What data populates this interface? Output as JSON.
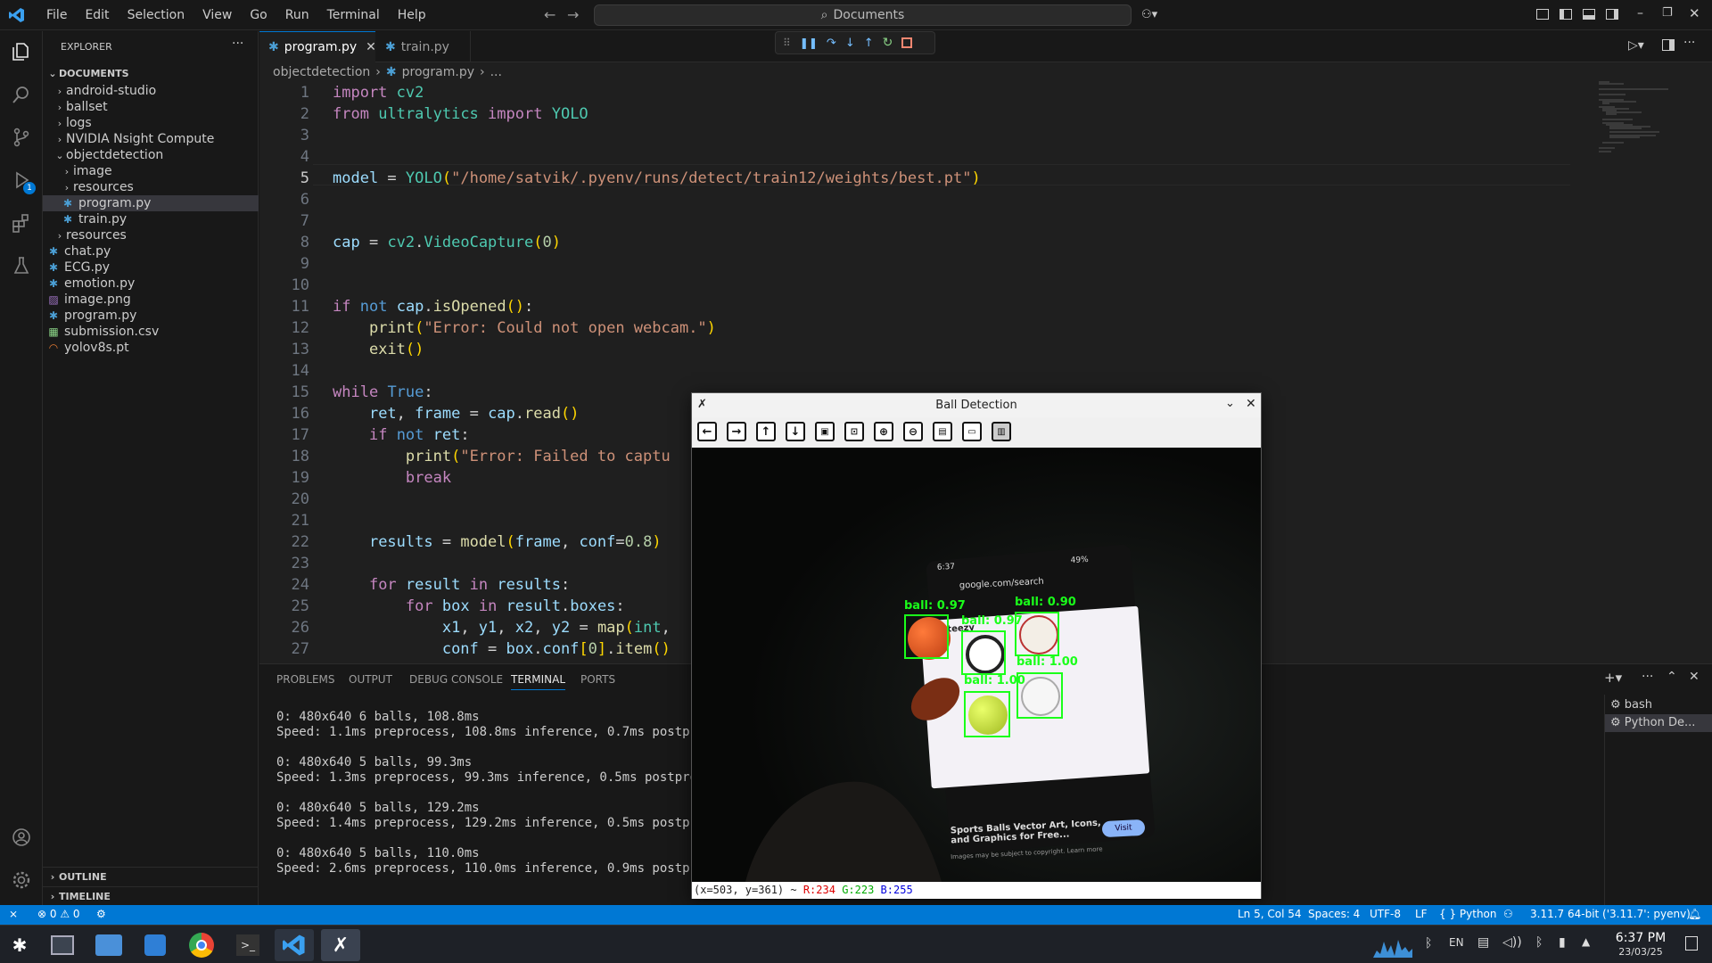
{
  "menu": [
    "File",
    "Edit",
    "Selection",
    "View",
    "Go",
    "Run",
    "Terminal",
    "Help"
  ],
  "search": {
    "label": "Documents"
  },
  "sidebar": {
    "title": "EXPLORER",
    "root": "DOCUMENTS",
    "items": [
      {
        "label": "android-studio",
        "type": "folder"
      },
      {
        "label": "ballset",
        "type": "folder"
      },
      {
        "label": "logs",
        "type": "folder"
      },
      {
        "label": "NVIDIA Nsight Compute",
        "type": "folder"
      },
      {
        "label": "objectdetection",
        "type": "folder-open"
      },
      {
        "label": "image",
        "type": "folder"
      },
      {
        "label": "resources",
        "type": "folder"
      },
      {
        "label": "program.py",
        "type": "py"
      },
      {
        "label": "train.py",
        "type": "py"
      },
      {
        "label": "resources",
        "type": "folder"
      },
      {
        "label": "chat.py",
        "type": "py"
      },
      {
        "label": "ECG.py",
        "type": "py"
      },
      {
        "label": "emotion.py",
        "type": "py"
      },
      {
        "label": "image.png",
        "type": "img"
      },
      {
        "label": "program.py",
        "type": "py"
      },
      {
        "label": "submission.csv",
        "type": "csv"
      },
      {
        "label": "yolov8s.pt",
        "type": "pt"
      }
    ],
    "outline": "OUTLINE",
    "timeline": "TIMELINE"
  },
  "tabs": [
    {
      "label": "program.py"
    },
    {
      "label": "train.py"
    }
  ],
  "breadcrumb": {
    "folder": "objectdetection",
    "file": "program.py",
    "rest": "..."
  },
  "code_lines": [
    "1",
    "2",
    "3",
    "4",
    "5",
    "6",
    "7",
    "8",
    "9",
    "10",
    "11",
    "12",
    "13",
    "14",
    "15",
    "16",
    "17",
    "18",
    "19",
    "20",
    "21",
    "22",
    "23",
    "24",
    "25",
    "26",
    "27"
  ],
  "panel": {
    "tabs": [
      "PROBLEMS",
      "OUTPUT",
      "DEBUG CONSOLE",
      "TERMINAL",
      "PORTS"
    ],
    "terminal": [
      "0: 480x640 6 balls, 108.8ms",
      "Speed: 1.1ms preprocess, 108.8ms inference, 0.7ms postproc",
      "",
      "0: 480x640 5 balls, 99.3ms",
      "Speed: 1.3ms preprocess, 99.3ms inference, 0.5ms postproce",
      "",
      "0: 480x640 5 balls, 129.2ms",
      "Speed: 1.4ms preprocess, 129.2ms inference, 0.5ms postproc",
      "",
      "0: 480x640 5 balls, 110.0ms",
      "Speed: 2.6ms preprocess, 110.0ms inference, 0.9ms postproc"
    ],
    "sessions": [
      "bash",
      "Python De..."
    ]
  },
  "window": {
    "title": "Ball Detection",
    "status_prefix": "(x=503, y=361) ~ ",
    "r": "R:234",
    "g": "G:223",
    "b": "B:255",
    "phone_time": "6:37",
    "phone_battery": "49%",
    "phone_url": "google.com/search",
    "site": "Vecteezy",
    "labels": [
      "ball: 0.97",
      "ball: 0.97",
      "ball: 0.90",
      "ball: 1.00",
      "ball: 1.00"
    ],
    "caption": "Sports Balls Vector Art, Icons, and Graphics for Free...",
    "visit": "Visit",
    "subcaption": "Images may be subject to copyright. Learn more"
  },
  "status": {
    "errors": "0",
    "warnings": "0",
    "position": "Ln 5, Col 54",
    "spaces": "Spaces: 4",
    "encoding": "UTF-8",
    "eol": "LF",
    "language": "Python",
    "interpreter": "3.11.7 64-bit ('3.11.7': pyenv)"
  },
  "clock": {
    "time": "6:37 PM",
    "date": "23/03/25"
  },
  "tray": {
    "lang": "EN"
  },
  "colors": {
    "accent": "#0078d4",
    "detect_box": "#1aff1a"
  }
}
